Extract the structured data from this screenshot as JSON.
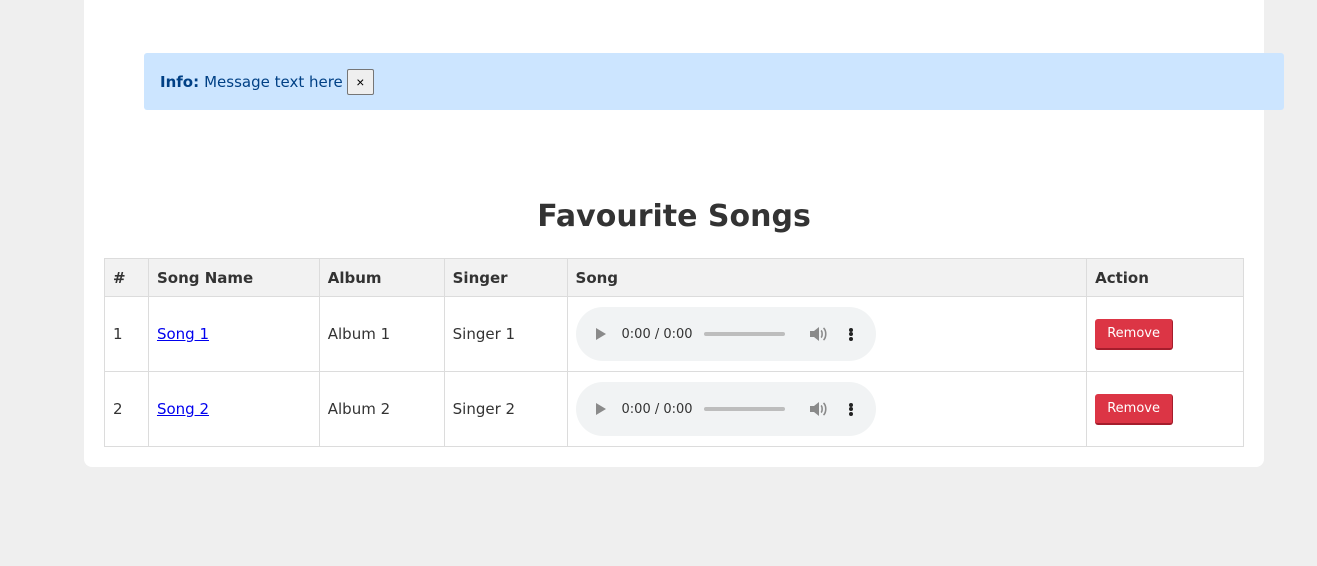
{
  "alert": {
    "label": "Info:",
    "message": "Message text here",
    "close_label": "×"
  },
  "page_title": "Favourite Songs",
  "table": {
    "headers": [
      "#",
      "Song Name",
      "Album",
      "Singer",
      "Song",
      "Action"
    ],
    "rows": [
      {
        "index": "1",
        "song_name": "Song 1",
        "album": "Album 1",
        "singer": "Singer 1",
        "time": "0:00 / 0:00",
        "action": "Remove"
      },
      {
        "index": "2",
        "song_name": "Song 2",
        "album": "Album 2",
        "singer": "Singer 2",
        "time": "0:00 / 0:00",
        "action": "Remove"
      }
    ]
  },
  "icons": {
    "play": "play-icon",
    "volume": "volume-icon",
    "more": "more-options-icon"
  },
  "colors": {
    "alert_bg": "#cce5ff",
    "alert_text": "#004085",
    "remove_button": "#dc3545",
    "link": "#0000ee"
  }
}
